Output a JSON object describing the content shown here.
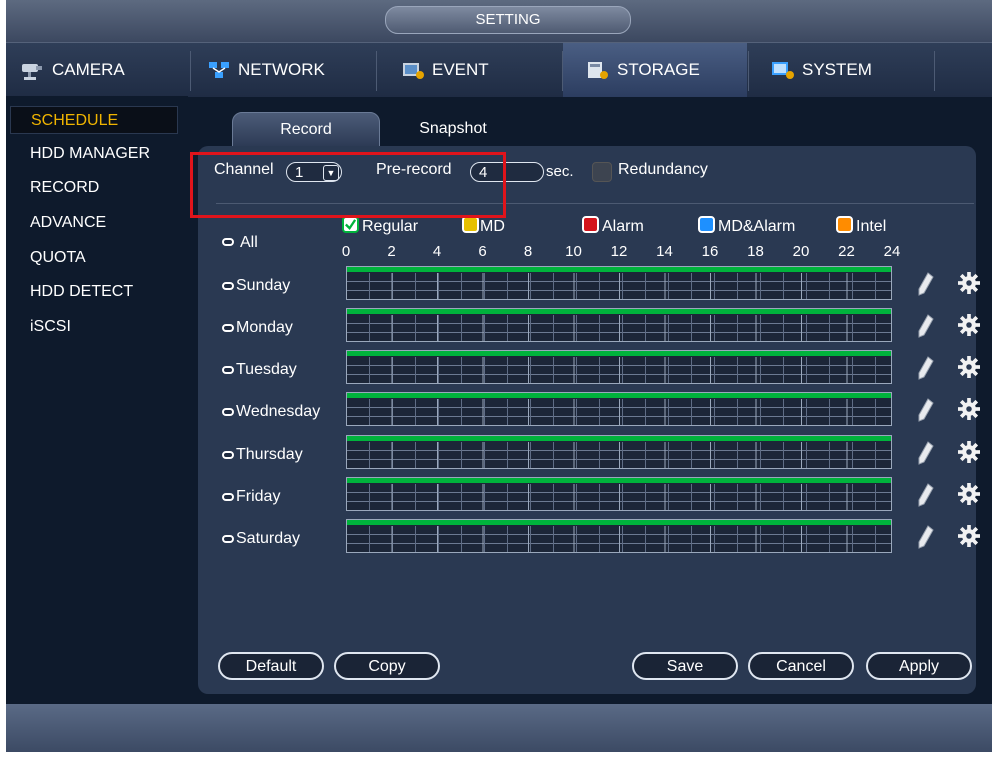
{
  "title": "SETTING",
  "top_tabs": [
    {
      "label": "CAMERA",
      "icon": "camera-icon"
    },
    {
      "label": "NETWORK",
      "icon": "network-icon"
    },
    {
      "label": "EVENT",
      "icon": "event-icon"
    },
    {
      "label": "STORAGE",
      "icon": "storage-icon",
      "active": true
    },
    {
      "label": "SYSTEM",
      "icon": "system-icon"
    }
  ],
  "sidebar": {
    "items": [
      {
        "label": "SCHEDULE",
        "active": true
      },
      {
        "label": "HDD MANAGER"
      },
      {
        "label": "RECORD"
      },
      {
        "label": "ADVANCE"
      },
      {
        "label": "QUOTA"
      },
      {
        "label": "HDD DETECT"
      },
      {
        "label": "iSCSI"
      }
    ]
  },
  "sub_tabs": {
    "record": "Record",
    "snapshot": "Snapshot"
  },
  "controls": {
    "channel_label": "Channel",
    "channel_value": "1",
    "prerecord_label": "Pre-record",
    "prerecord_value": "4",
    "sec_label": "sec.",
    "redundancy_label": "Redundancy"
  },
  "legend": [
    {
      "label": "Regular",
      "color": "#00b33c",
      "checked": true
    },
    {
      "label": "MD",
      "color": "#e6c000"
    },
    {
      "label": "Alarm",
      "color": "#d4141b"
    },
    {
      "label": "MD&Alarm",
      "color": "#1e90ff"
    },
    {
      "label": "Intel",
      "color": "#ff8c00"
    }
  ],
  "all_label": "All",
  "hours": [
    "0",
    "2",
    "4",
    "6",
    "8",
    "10",
    "12",
    "14",
    "16",
    "18",
    "20",
    "22",
    "24"
  ],
  "days": [
    "Sunday",
    "Monday",
    "Tuesday",
    "Wednesday",
    "Thursday",
    "Friday",
    "Saturday"
  ],
  "buttons": {
    "default": "Default",
    "copy": "Copy",
    "save": "Save",
    "cancel": "Cancel",
    "apply": "Apply"
  },
  "colors": {
    "active_sidebar": "#f0b400",
    "regular_record": "#00b33c",
    "highlight": "#e0141b"
  }
}
